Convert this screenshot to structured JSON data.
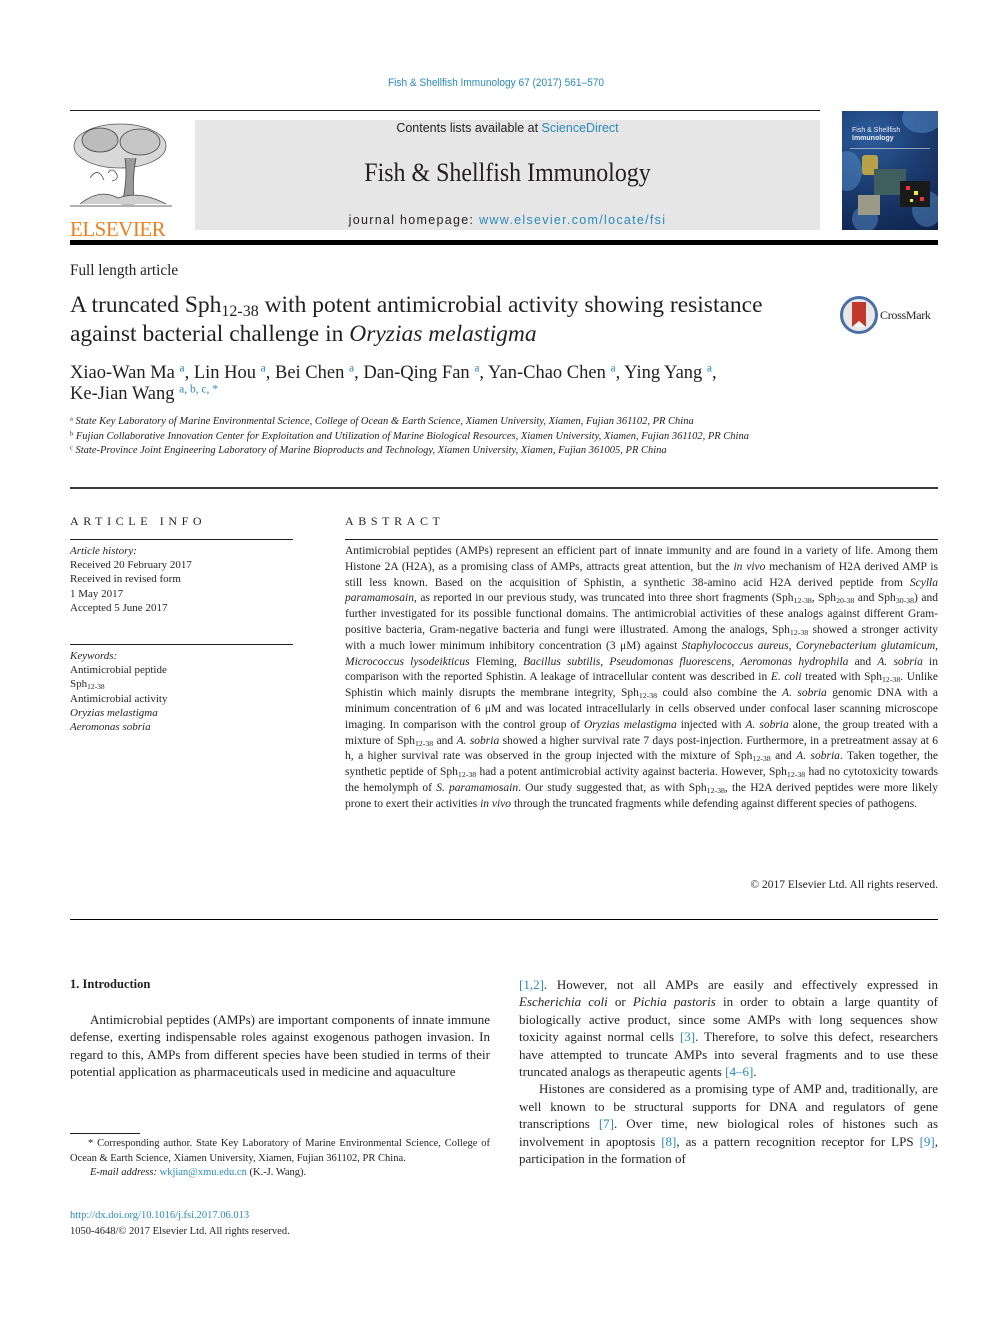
{
  "citation": "Fish & Shellfish Immunology 67 (2017) 561–570",
  "publisher": {
    "logo_text": "ELSEVIER",
    "brand_color": "#f07f1e"
  },
  "banner": {
    "contents_prefix": "Contents lists available at ",
    "contents_link": "ScienceDirect",
    "journal_title": "Fish & Shellfish Immunology",
    "homepage_prefix": "journal homepage: ",
    "homepage_link": "www.elsevier.com/locate/fsi",
    "link_color": "#2a8ab9"
  },
  "cover": {
    "title_line1": "Fish & Shellfish",
    "title_line2": "Immunology"
  },
  "article_type": "Full length article",
  "title": {
    "part1": "A truncated Sph",
    "sub": "12-38",
    "part2": " with potent antimicrobial activity showing resistance against bacterial challenge in ",
    "italic": "Oryzias melastigma"
  },
  "crossmark_label": "CrossMark",
  "authors": [
    {
      "name": "Xiao-Wan Ma",
      "aff": "a"
    },
    {
      "name": "Lin Hou",
      "aff": "a"
    },
    {
      "name": "Bei Chen",
      "aff": "a"
    },
    {
      "name": "Dan-Qing Fan",
      "aff": "a"
    },
    {
      "name": "Yan-Chao Chen",
      "aff": "a"
    },
    {
      "name": "Ying Yang",
      "aff": "a"
    },
    {
      "name": "Ke-Jian Wang",
      "aff": "a, b, c, *"
    }
  ],
  "affiliations": [
    {
      "key": "a",
      "text": "State Key Laboratory of Marine Environmental Science, College of Ocean & Earth Science, Xiamen University, Xiamen, Fujian 361102, PR China"
    },
    {
      "key": "b",
      "text": "Fujian Collaborative Innovation Center for Exploitation and Utilization of Marine Biological Resources, Xiamen University, Xiamen, Fujian 361102, PR China"
    },
    {
      "key": "c",
      "text": "State-Province Joint Engineering Laboratory of Marine Bioproducts and Technology, Xiamen University, Xiamen, Fujian 361005, PR China"
    }
  ],
  "article_info": {
    "heading": "ARTICLE INFO",
    "history_label": "Article history:",
    "history": [
      "Received 20 February 2017",
      "Received in revised form",
      "1 May 2017",
      "Accepted 5 June 2017"
    ],
    "keywords_label": "Keywords:",
    "keywords": [
      "Antimicrobial peptide",
      "Sph12-38",
      "Antimicrobial activity",
      "Oryzias melastigma",
      "Aeromonas sobria"
    ]
  },
  "abstract": {
    "heading": "ABSTRACT",
    "t1": "Antimicrobial peptides (AMPs) represent an efficient part of innate immunity and are found in a variety of life. Among them Histone 2A (H2A), as a promising class of AMPs, attracts great attention, but the ",
    "i1": "in vivo",
    "t2": " mechanism of H2A derived AMP is still less known. Based on the acquisition of Sphistin, a synthetic 38-amino acid H2A derived peptide from ",
    "i2": "Scylla paramamosain",
    "t3": ", as reported in our previous study, was truncated into three short fragments (Sph",
    "s1": "12-38",
    "t4": ", Sph",
    "s2": "20-38",
    "t5": " and Sph",
    "s3": "30-38",
    "t6": ") and further investigated for its possible functional domains. The antimicrobial activities of these analogs against different Gram-positive bacteria, Gram-negative bacteria and fungi were illustrated. Among the analogs, Sph",
    "t7": " showed a stronger activity with a much lower minimum inhibitory concentration (3 μM) against ",
    "i3": "Staphylococcus aureus, Corynebacterium glutamicum, Micrococcus lysodeikticus",
    "t8": " Fleming, ",
    "i4": "Bacillus subtilis, Pseudomonas fluorescens, Aeromonas hydrophila",
    "t9": " and ",
    "i5": "A. sobria",
    "t10": " in comparison with the reported Sphistin. A leakage of intracellular content was described in ",
    "i6": "E. coli",
    "t11": " treated with Sph",
    "t12": ". Unlike Sphistin which mainly disrupts the membrane integrity, Sph",
    "t13": " could also combine the ",
    "t14": " genomic DNA with a minimum concentration of 6 μM and was located intracellularly in cells observed under confocal laser scanning microscope imaging. In comparison with the control group of ",
    "i7": "Oryzias melastigma",
    "t15": " injected with ",
    "t16": " alone, the group treated with a mixture of Sph",
    "t17": " and ",
    "t18": " showed a higher survival rate 7 days post-injection. Furthermore, in a pretreatment assay at 6 h, a higher survival rate was observed in the group injected with the mixture of Sph",
    "t19": ". Taken together, the synthetic peptide of Sph",
    "t20": " had a potent antimicrobial activity against bacteria. However, Sph",
    "t21": " had no cytotoxicity towards the hemolymph of ",
    "i8": "S. paramamosain",
    "t22": ". Our study suggested that, as with Sph",
    "t23": ", the H2A derived peptides were more likely prone to exert their activities ",
    "t24": " through the truncated fragments while defending against different species of pathogens.",
    "copyright": "© 2017 Elsevier Ltd. All rights reserved."
  },
  "introduction": {
    "heading": "1.  Introduction",
    "p1": "Antimicrobial peptides (AMPs) are important components of innate immune defense, exerting indispensable roles against exogenous pathogen invasion. In regard to this, AMPs from different species have been studied in terms of their potential application as pharmaceuticals used in medicine and aquaculture ",
    "ref12": "[1,2]",
    "p1b": ". However, not all AMPs are easily and effectively expressed in ",
    "i_ecoli": "Escherichia coli",
    "p1c": " or ",
    "i_pichia": "Pichia pastoris",
    "p1d": " in order to obtain a large quantity of biologically active product, since some AMPs with long sequences show toxicity against normal cells ",
    "ref3": "[3]",
    "p1e": ". Therefore, to solve this defect, researchers have attempted to truncate AMPs into several fragments and to use these truncated analogs as therapeutic agents ",
    "ref46": "[4–6]",
    "p1f": ".",
    "p2a": "Histones are considered as a promising type of AMP and, traditionally, are well known to be structural supports for DNA and regulators of gene transcriptions ",
    "ref7": "[7]",
    "p2b": ". Over time, new biological roles of histones such as involvement in apoptosis ",
    "ref8": "[8]",
    "p2c": ", as a pattern recognition receptor for LPS ",
    "ref9": "[9]",
    "p2d": ", participation in the formation of"
  },
  "footnote": {
    "corresponding": "* Corresponding author. State Key Laboratory of Marine Environmental Science, College of Ocean & Earth Science, Xiamen University, Xiamen, Fujian 361102, PR China.",
    "email_label": "E-mail address: ",
    "email": "wkjian@xmu.edu.cn",
    "email_suffix": " (K.-J. Wang).",
    "doi": "http://dx.doi.org/10.1016/j.fsi.2017.06.013",
    "issn": "1050-4648/© 2017 Elsevier Ltd. All rights reserved."
  }
}
